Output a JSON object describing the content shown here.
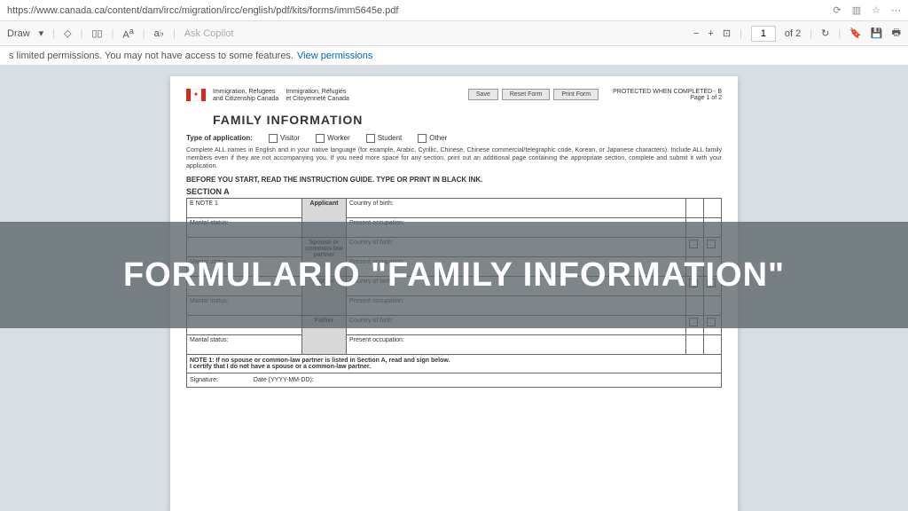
{
  "url": "https://www.canada.ca/content/dam/ircc/migration/ircc/english/pdf/kits/forms/imm5645e.pdf",
  "toolbar": {
    "draw": "Draw",
    "copilot": "Ask Copilot",
    "page_current": "1",
    "page_total": "of 2"
  },
  "perm": {
    "text": "s limited permissions. You may not have access to some features.",
    "link": "View permissions"
  },
  "doc": {
    "dept_en_l1": "Immigration, Refugees",
    "dept_en_l2": "and Citizenship Canada",
    "dept_fr_l1": "Immigration, Réfugiés",
    "dept_fr_l2": "et Citoyenneté Canada",
    "btn_save": "Save",
    "btn_reset": "Reset Form",
    "btn_print": "Print Form",
    "protected": "PROTECTED WHEN COMPLETED - B",
    "page_of": "Page 1 of 2",
    "title": "FAMILY INFORMATION",
    "type_label": "Type of application:",
    "opt_visitor": "Visitor",
    "opt_worker": "Worker",
    "opt_student": "Student",
    "opt_other": "Other",
    "instr": "Complete ALL names in English and in your native language (for example, Arabic, Cyrillic, Chinese, Chinese commercial/telegraphic code, Korean, or Japanese characters). Include ALL family members even if they are not accompanying you. If you need more space for any section, print out an additional page containing the appropriate section, complete and submit it with your application.",
    "before": "BEFORE YOU START, READ THE INSTRUCTION GUIDE. TYPE OR PRINT IN BLACK INK.",
    "section_a": "SECTION A",
    "role_applicant": "Applicant",
    "role_spouse": "Spouse or common-law partner",
    "role_mother": "Mother",
    "role_father": "Father",
    "marital_status": "Marital status:",
    "country_birth": "Country of birth:",
    "present_occ": "Present occupation:",
    "see_note": "E NOTE 1",
    "note1": "NOTE 1: If no spouse or common-law partner is listed in Section A, read and sign below.",
    "certify": "I certify that I do not have a spouse or a common-law partner.",
    "signature": "Signature:",
    "date": "Date (YYYY-MM-DD):"
  },
  "overlay": {
    "text": "FORMULARIO \"FAMILY INFORMATION\""
  }
}
